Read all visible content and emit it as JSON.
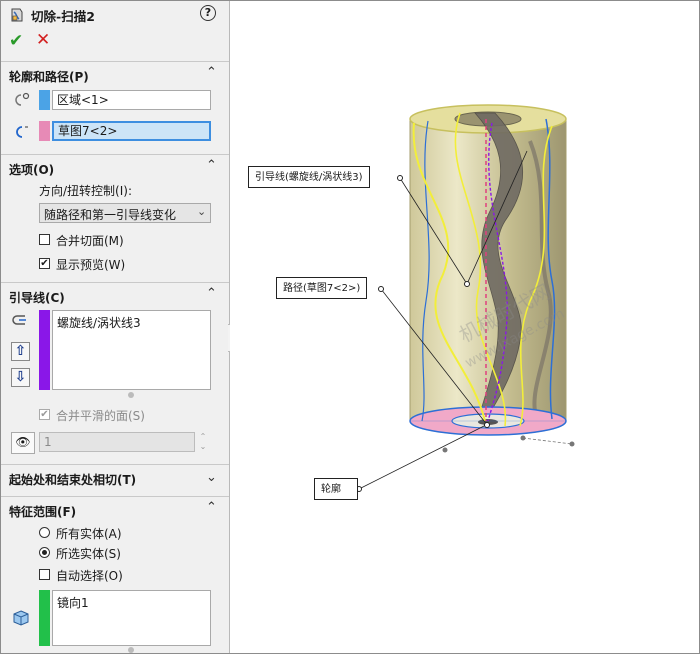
{
  "header": {
    "title": "切除-扫描2"
  },
  "sections": {
    "profile_path": {
      "heading": "轮廓和路径(P)",
      "profile_value": "区域<1>",
      "path_value": "草图7<2>",
      "profile_color": "#4ba3e6",
      "path_color": "#e78ab6"
    },
    "options": {
      "heading": "选项(O)",
      "orientation_label": "方向/扭转控制(I):",
      "orientation_value": "随路径和第一引导线变化",
      "merge_tangent": {
        "label": "合并切面(M)",
        "checked": false
      },
      "show_preview": {
        "label": "显示预览(W)",
        "checked": true
      }
    },
    "guide_curves": {
      "heading": "引导线(C)",
      "items": [
        "螺旋线/涡状线3"
      ],
      "color": "#8a17e8",
      "merge_smooth": {
        "label": "合并平滑的面(S)",
        "checked": true
      },
      "spin_value": "1"
    },
    "tangency": {
      "heading": "起始处和结束处相切(T)"
    },
    "feature_scope": {
      "heading": "特征范围(F)",
      "all_bodies": "所有实体(A)",
      "selected_bodies": "所选实体(S)",
      "auto_select": "自动选择(O)",
      "bodies": [
        "镜向1"
      ],
      "color": "#22c04a"
    }
  },
  "viewport": {
    "callouts": {
      "guide": "引导线(螺旋线/涡状线3)",
      "path": "路径(草图7<2>)",
      "profile": "轮廓"
    },
    "watermark": [
      "机械时代网",
      "www.jxage.com"
    ]
  }
}
